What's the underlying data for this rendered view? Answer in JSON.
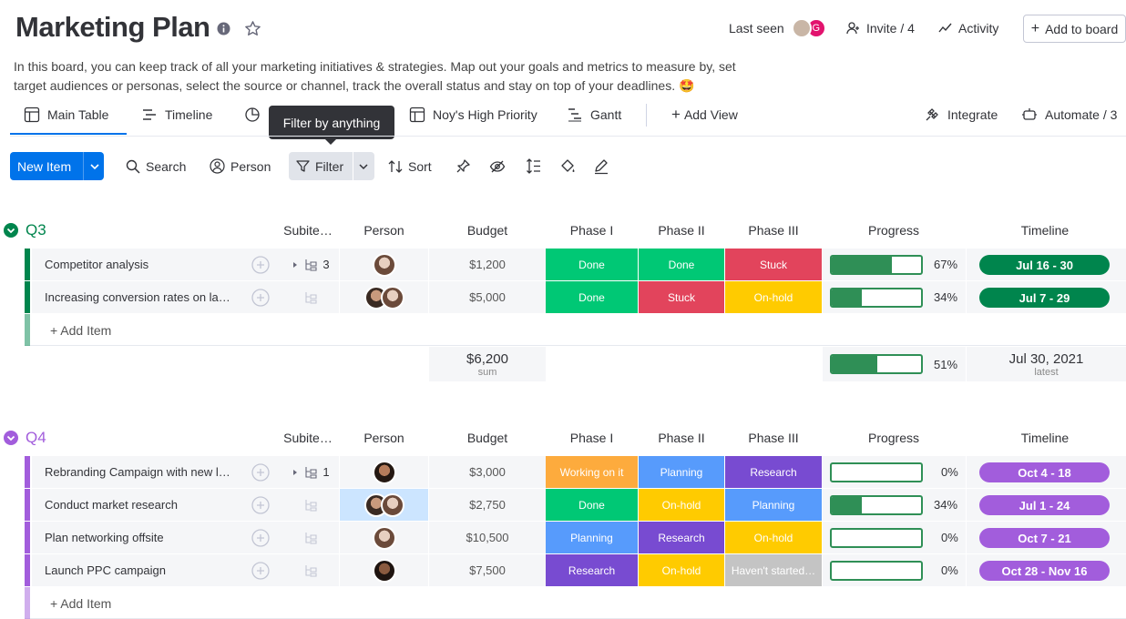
{
  "header": {
    "title": "Marketing Plan",
    "last_seen_label": "Last seen",
    "avatar_letter": "G",
    "invite_label": "Invite / 4",
    "activity_label": "Activity",
    "add_to_board_label": "Add to board",
    "description": "In this board, you can keep track of all your marketing initiatives & strategies. Map out your goals and metrics to measure by, set target audiences or personas, select the source or channel, track the overall status and stay on top of your deadlines. 🤩"
  },
  "tabs": [
    {
      "label": "Main Table",
      "icon": "table-icon"
    },
    {
      "label": "Timeline",
      "icon": "timeline-icon"
    },
    {
      "label": "Noy's High Priority",
      "icon": "table-icon"
    },
    {
      "label": "Gantt",
      "icon": "gantt-icon"
    },
    {
      "label": "Add View",
      "icon": "plus-icon"
    },
    {
      "label": "Integrate",
      "icon": "integrate-icon"
    },
    {
      "label": "Automate / 3",
      "icon": "robot-icon"
    }
  ],
  "tooltip": "Filter by anything",
  "toolbar": {
    "new_item": "New Item",
    "search": "Search",
    "person": "Person",
    "filter": "Filter",
    "sort": "Sort"
  },
  "columns": {
    "subitems": "Subite…",
    "person": "Person",
    "budget": "Budget",
    "phase1": "Phase I",
    "phase2": "Phase II",
    "phase3": "Phase III",
    "progress": "Progress",
    "timeline": "Timeline"
  },
  "colors": {
    "done": "#00c875",
    "stuck": "#e2445c",
    "onhold": "#ffcb00",
    "working": "#fdab3d",
    "planning": "#579bfc",
    "research": "#784bd1",
    "notstarted": "#c4c4c4",
    "q3": "#00854d",
    "q4": "#a25ddc"
  },
  "groups": [
    {
      "name": "Q3",
      "color": "#00854d",
      "add_item": "+ Add Item",
      "rows": [
        {
          "name": "Competitor analysis",
          "subitems": "3",
          "budget": "$1,200",
          "phases": [
            "Done",
            "Done",
            "Stuck"
          ],
          "phase_colors": [
            "#00c875",
            "#00c875",
            "#e2445c"
          ],
          "progress": 67,
          "progress_label": "67%",
          "timeline": "Jul 16 - 30",
          "people": 1
        },
        {
          "name": "Increasing conversion rates on lan…",
          "subitems": "",
          "budget": "$5,000",
          "phases": [
            "Done",
            "Stuck",
            "On-hold"
          ],
          "phase_colors": [
            "#00c875",
            "#e2445c",
            "#ffcb00"
          ],
          "progress": 34,
          "progress_label": "34%",
          "timeline": "Jul 7 - 29",
          "people": 2
        }
      ],
      "summary": {
        "budget": "$6,200",
        "budget_sub": "sum",
        "progress": 51,
        "progress_label": "51%",
        "timeline": "Jul 30, 2021",
        "timeline_sub": "latest"
      }
    },
    {
      "name": "Q4",
      "color": "#a25ddc",
      "add_item": "+ Add Item",
      "rows": [
        {
          "name": "Rebranding Campaign with new lo…",
          "subitems": "1",
          "budget": "$3,000",
          "phases": [
            "Working on it",
            "Planning",
            "Research"
          ],
          "phase_colors": [
            "#fdab3d",
            "#579bfc",
            "#784bd1"
          ],
          "progress": 0,
          "progress_label": "0%",
          "timeline": "Oct 4 - 18",
          "people": 1
        },
        {
          "name": "Conduct market research",
          "subitems": "",
          "budget": "$2,750",
          "phases": [
            "Done",
            "On-hold",
            "Planning"
          ],
          "phase_colors": [
            "#00c875",
            "#ffcb00",
            "#579bfc"
          ],
          "progress": 34,
          "progress_label": "34%",
          "timeline": "Jul 1 - 24",
          "people": 2
        },
        {
          "name": "Plan networking offsite",
          "subitems": "",
          "budget": "$10,500",
          "phases": [
            "Planning",
            "Research",
            "On-hold"
          ],
          "phase_colors": [
            "#579bfc",
            "#784bd1",
            "#ffcb00"
          ],
          "progress": 0,
          "progress_label": "0%",
          "timeline": "Oct 7 - 21",
          "people": 1
        },
        {
          "name": "Launch PPC campaign",
          "subitems": "",
          "budget": "$7,500",
          "phases": [
            "Research",
            "On-hold",
            "Haven't started…"
          ],
          "phase_colors": [
            "#784bd1",
            "#ffcb00",
            "#c4c4c4"
          ],
          "progress": 0,
          "progress_label": "0%",
          "timeline": "Oct 28 - Nov 16",
          "people": 1
        }
      ]
    }
  ]
}
